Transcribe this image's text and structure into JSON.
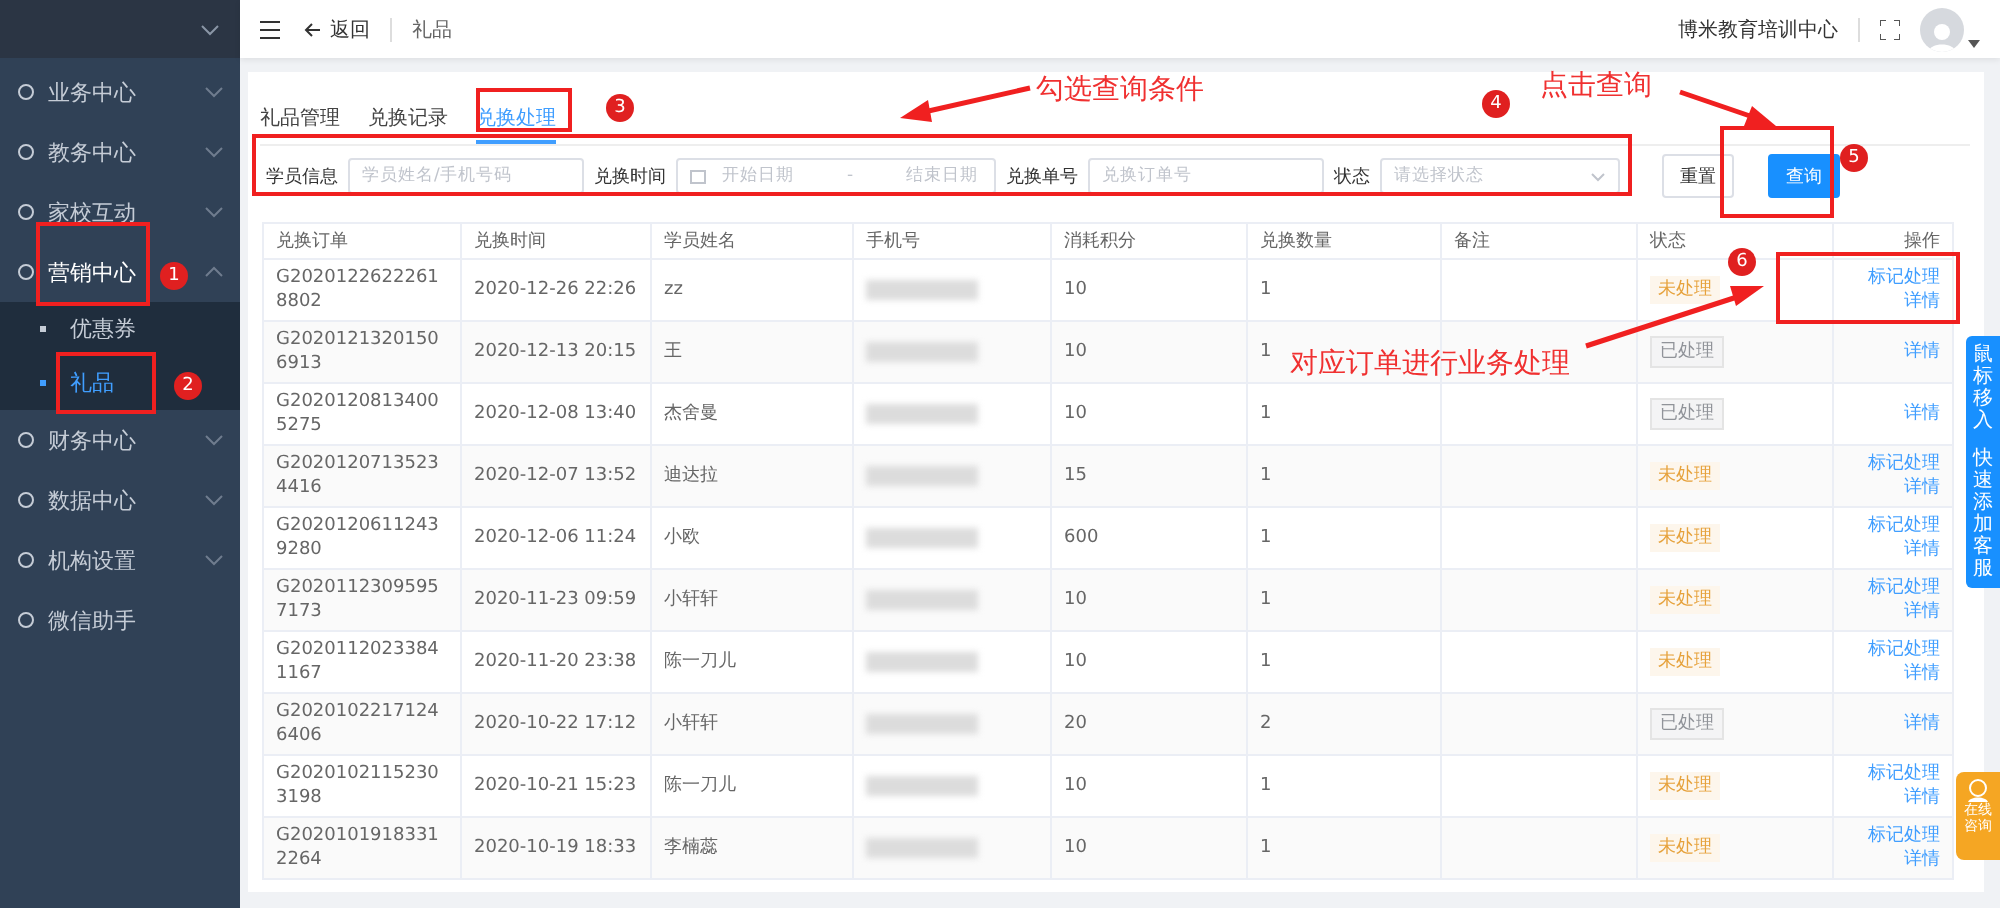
{
  "sidebar": {
    "items": [
      {
        "label": "业务中心",
        "expanded": false
      },
      {
        "label": "教务中心",
        "expanded": false
      },
      {
        "label": "家校互动",
        "expanded": false
      },
      {
        "label": "营销中心",
        "expanded": true,
        "children": [
          {
            "label": "优惠券",
            "selected": false
          },
          {
            "label": "礼品",
            "selected": true
          }
        ]
      },
      {
        "label": "财务中心",
        "expanded": false
      },
      {
        "label": "数据中心",
        "expanded": false
      },
      {
        "label": "机构设置",
        "expanded": false
      },
      {
        "label": "微信助手"
      }
    ]
  },
  "header": {
    "back": "返回",
    "breadcrumb": "礼品",
    "org_name": "博米教育培训中心"
  },
  "tabs": [
    {
      "label": "礼品管理",
      "selected": false
    },
    {
      "label": "兑换记录",
      "selected": false
    },
    {
      "label": "兑换处理",
      "selected": true
    }
  ],
  "filters": [
    {
      "kind": "text",
      "label": "学员信息",
      "placeholder": "学员姓名/手机号码"
    },
    {
      "kind": "daterange",
      "label": "兑换时间",
      "placeholder": "开始日期",
      "placeholder_end": "结束日期",
      "separator": "-"
    },
    {
      "kind": "text",
      "label": "兑换单号",
      "placeholder": "兑换订单号"
    },
    {
      "kind": "select",
      "label": "状态",
      "placeholder": "请选择状态"
    }
  ],
  "buttons": {
    "reset": "重置",
    "query": "查询"
  },
  "table": {
    "columns": [
      "兑换订单",
      "兑换时间",
      "学员姓名",
      "手机号",
      "消耗积分",
      "兑换数量",
      "备注",
      "状态",
      "操作"
    ],
    "rows": [
      {
        "order_id": "G20201226222618802",
        "time": "2020-12-26 22:26",
        "name": "zz",
        "points": "10",
        "quantity": "1",
        "status": {
          "kind": "pending",
          "label": "未处理"
        },
        "actions": [
          "标记处理",
          "详情"
        ]
      },
      {
        "order_id": "G20201213201506913",
        "time": "2020-12-13 20:15",
        "name": "王",
        "points": "10",
        "quantity": "1",
        "status": {
          "kind": "done",
          "label": "已处理"
        },
        "actions": [
          "详情"
        ]
      },
      {
        "order_id": "G20201208134005275",
        "time": "2020-12-08 13:40",
        "name": "杰舍曼",
        "points": "10",
        "quantity": "1",
        "status": {
          "kind": "done",
          "label": "已处理"
        },
        "actions": [
          "详情"
        ]
      },
      {
        "order_id": "G20201207135234416",
        "time": "2020-12-07 13:52",
        "name": "迪达拉",
        "points": "15",
        "quantity": "1",
        "status": {
          "kind": "pending",
          "label": "未处理"
        },
        "actions": [
          "标记处理",
          "详情"
        ]
      },
      {
        "order_id": "G20201206112439280",
        "time": "2020-12-06 11:24",
        "name": "小欧",
        "points": "600",
        "quantity": "1",
        "status": {
          "kind": "pending",
          "label": "未处理"
        },
        "actions": [
          "标记处理",
          "详情"
        ]
      },
      {
        "order_id": "G20201123095957173",
        "time": "2020-11-23 09:59",
        "name": "小轩轩",
        "points": "10",
        "quantity": "1",
        "status": {
          "kind": "pending",
          "label": "未处理"
        },
        "actions": [
          "标记处理",
          "详情"
        ]
      },
      {
        "order_id": "G20201120233841167",
        "time": "2020-11-20 23:38",
        "name": "陈一刀儿",
        "points": "10",
        "quantity": "1",
        "status": {
          "kind": "pending",
          "label": "未处理"
        },
        "actions": [
          "标记处理",
          "详情"
        ]
      },
      {
        "order_id": "G20201022171246406",
        "time": "2020-10-22 17:12",
        "name": "小轩轩",
        "points": "20",
        "quantity": "2",
        "status": {
          "kind": "done",
          "label": "已处理"
        },
        "actions": [
          "详情"
        ]
      },
      {
        "order_id": "G20201021152303198",
        "time": "2020-10-21 15:23",
        "name": "陈一刀儿",
        "points": "10",
        "quantity": "1",
        "status": {
          "kind": "pending",
          "label": "未处理"
        },
        "actions": [
          "标记处理",
          "详情"
        ]
      },
      {
        "order_id": "G20201019183312264",
        "time": "2020-10-19 18:33",
        "name": "李楠蕊",
        "points": "10",
        "quantity": "1",
        "status": {
          "kind": "pending",
          "label": "未处理"
        },
        "actions": [
          "标记处理",
          "详情"
        ]
      }
    ]
  },
  "side_tabs": {
    "support": [
      "鼠标移入",
      "快速添加客服"
    ],
    "consult": "在线咨询"
  },
  "annotations": {
    "markers": [
      "1",
      "2",
      "3",
      "4",
      "5",
      "6"
    ],
    "notes": [
      "勾选查询条件",
      "点击查询",
      "对应订单进行业务处理"
    ]
  }
}
